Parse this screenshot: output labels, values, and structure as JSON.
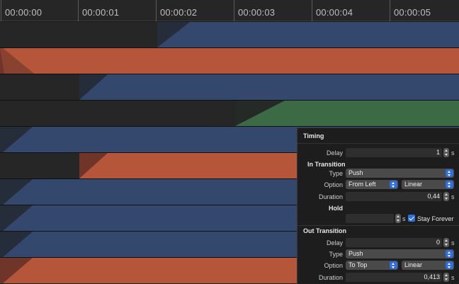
{
  "ruler": {
    "labels": [
      "00:00:00",
      "00:00:01",
      "00:00:02",
      "00:00:03",
      "00:00:04",
      "00:00:05"
    ]
  },
  "colors": {
    "blue": "#34476c",
    "blue_ramp": "#2b3b59",
    "orange": "#b5553a",
    "orange_ramp": "#7a3e2f",
    "green": "#3c6a45",
    "green_ramp": "#2f5138",
    "empty": "#262626"
  },
  "panel": {
    "timing_header": "Timing",
    "delay_label": "Delay",
    "delay_value": "1",
    "delay_unit": "s",
    "in_transition": {
      "header": "In Transition",
      "type_label": "Type",
      "type_value": "Push",
      "option_label": "Option",
      "option_direction": "From Left",
      "option_easing": "Linear",
      "duration_label": "Duration",
      "duration_value": "0,44",
      "duration_unit": "s"
    },
    "hold": {
      "header": "Hold",
      "value": "",
      "unit": "s",
      "stay_forever_label": "Stay Forever",
      "stay_forever_checked": true
    },
    "out_transition": {
      "header": "Out Transition",
      "delay_label": "Delay",
      "delay_value": "0",
      "delay_unit": "s",
      "type_label": "Type",
      "type_value": "Push",
      "option_label": "Option",
      "option_direction": "To Top",
      "option_easing": "Linear",
      "duration_label": "Duration",
      "duration_value": "0,413",
      "duration_unit": "s"
    }
  }
}
